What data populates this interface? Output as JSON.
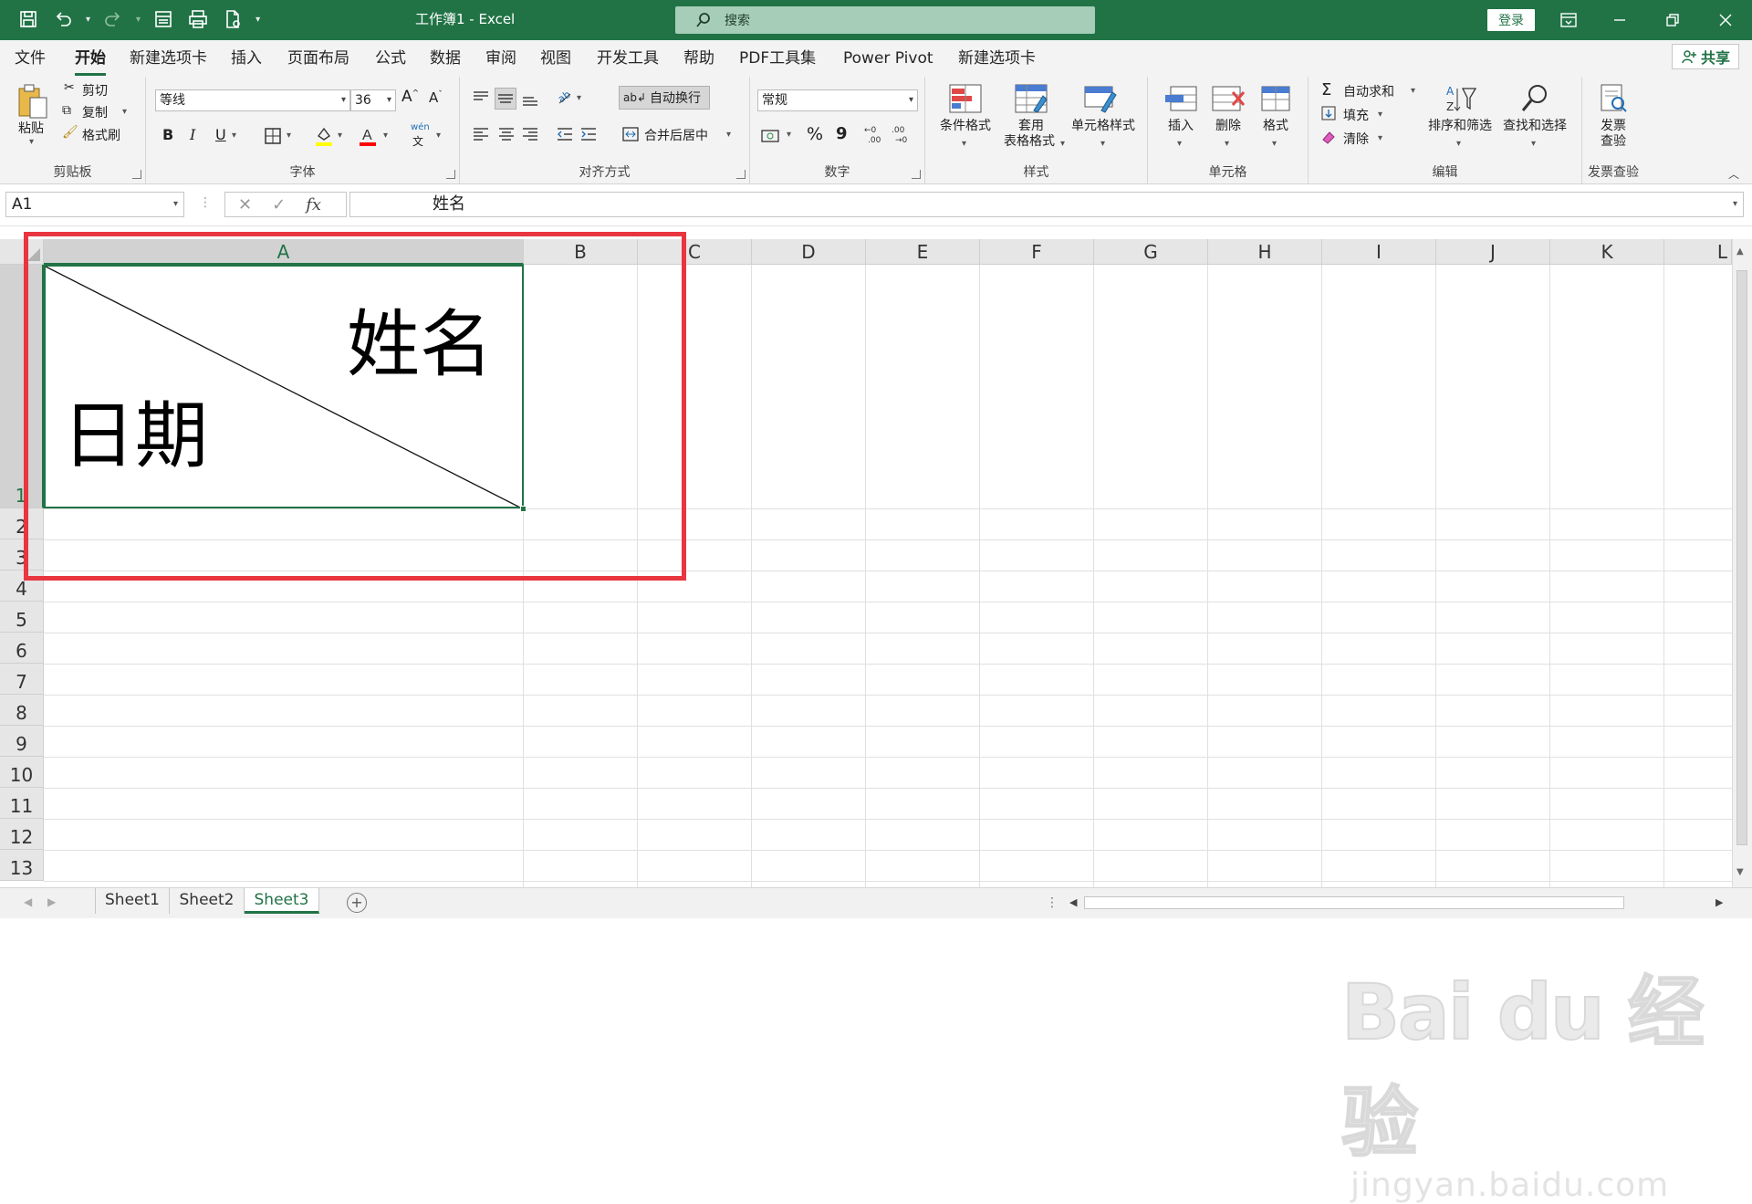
{
  "title_bar": {
    "document_title": "工作簿1  -  Excel",
    "search_placeholder": "搜索",
    "login_label": "登录",
    "window_controls": [
      "ribbon-display-icon",
      "minimize-icon",
      "restore-icon",
      "close-icon"
    ],
    "quick_access": [
      "save-icon",
      "undo-icon",
      "redo-icon",
      "form-icon",
      "print-preview-icon",
      "new-doc-icon",
      "customize-icon"
    ]
  },
  "menu": {
    "items": [
      "文件",
      "开始",
      "新建选项卡",
      "插入",
      "页面布局",
      "公式",
      "数据",
      "审阅",
      "视图",
      "开发工具",
      "帮助",
      "PDF工具集",
      "Power Pivot",
      "新建选项卡"
    ],
    "active": "开始",
    "share_label": "共享"
  },
  "ribbon": {
    "clipboard": {
      "label": "剪贴板",
      "paste": "粘贴",
      "cut": "剪切",
      "copy": "复制",
      "format_painter": "格式刷"
    },
    "font": {
      "label": "字体",
      "font_name": "等线",
      "font_size": "36",
      "bold": "B",
      "italic": "I",
      "underline": "U",
      "phonetic": "wén"
    },
    "alignment": {
      "label": "对齐方式",
      "wrap_text": "自动换行",
      "merge_center": "合并后居中"
    },
    "number": {
      "label": "数字",
      "format": "常规",
      "percent": "%",
      "comma": "9"
    },
    "styles": {
      "label": "样式",
      "conditional": "条件格式",
      "table_line1": "套用",
      "table_line2": "表格格式",
      "cell_styles": "单元格样式"
    },
    "cells": {
      "label": "单元格",
      "insert": "插入",
      "delete": "删除",
      "format": "格式"
    },
    "editing": {
      "label": "编辑",
      "autosum": "自动求和",
      "fill": "填充",
      "clear": "清除",
      "sort_filter": "排序和筛选",
      "find_select": "查找和选择"
    },
    "invoice": {
      "label": "发票查验",
      "btn_line1": "发票",
      "btn_line2": "查验"
    }
  },
  "formula_bar": {
    "name_box": "A1",
    "fx": "fx",
    "content": "姓名"
  },
  "grid": {
    "columns": [
      "A",
      "B",
      "C",
      "D",
      "E",
      "F",
      "G",
      "H",
      "I",
      "J",
      "K",
      "L"
    ],
    "selected_column": "A",
    "rows": [
      "1",
      "2",
      "3",
      "4",
      "5",
      "6",
      "7",
      "8",
      "9",
      "10",
      "11",
      "12",
      "13"
    ],
    "selected_row": "1",
    "cell_a1": {
      "top_right_text": "姓名",
      "bottom_left_text": "日期",
      "diagonal_border": true
    }
  },
  "watermark": {
    "brand": "Bai du 经验",
    "url": "jingyan.baidu.com"
  },
  "sheets": {
    "tabs": [
      "Sheet1",
      "Sheet2",
      "Sheet3"
    ],
    "active": "Sheet3"
  },
  "colors": {
    "excel_green": "#217346",
    "highlight_red": "#e8353f"
  }
}
